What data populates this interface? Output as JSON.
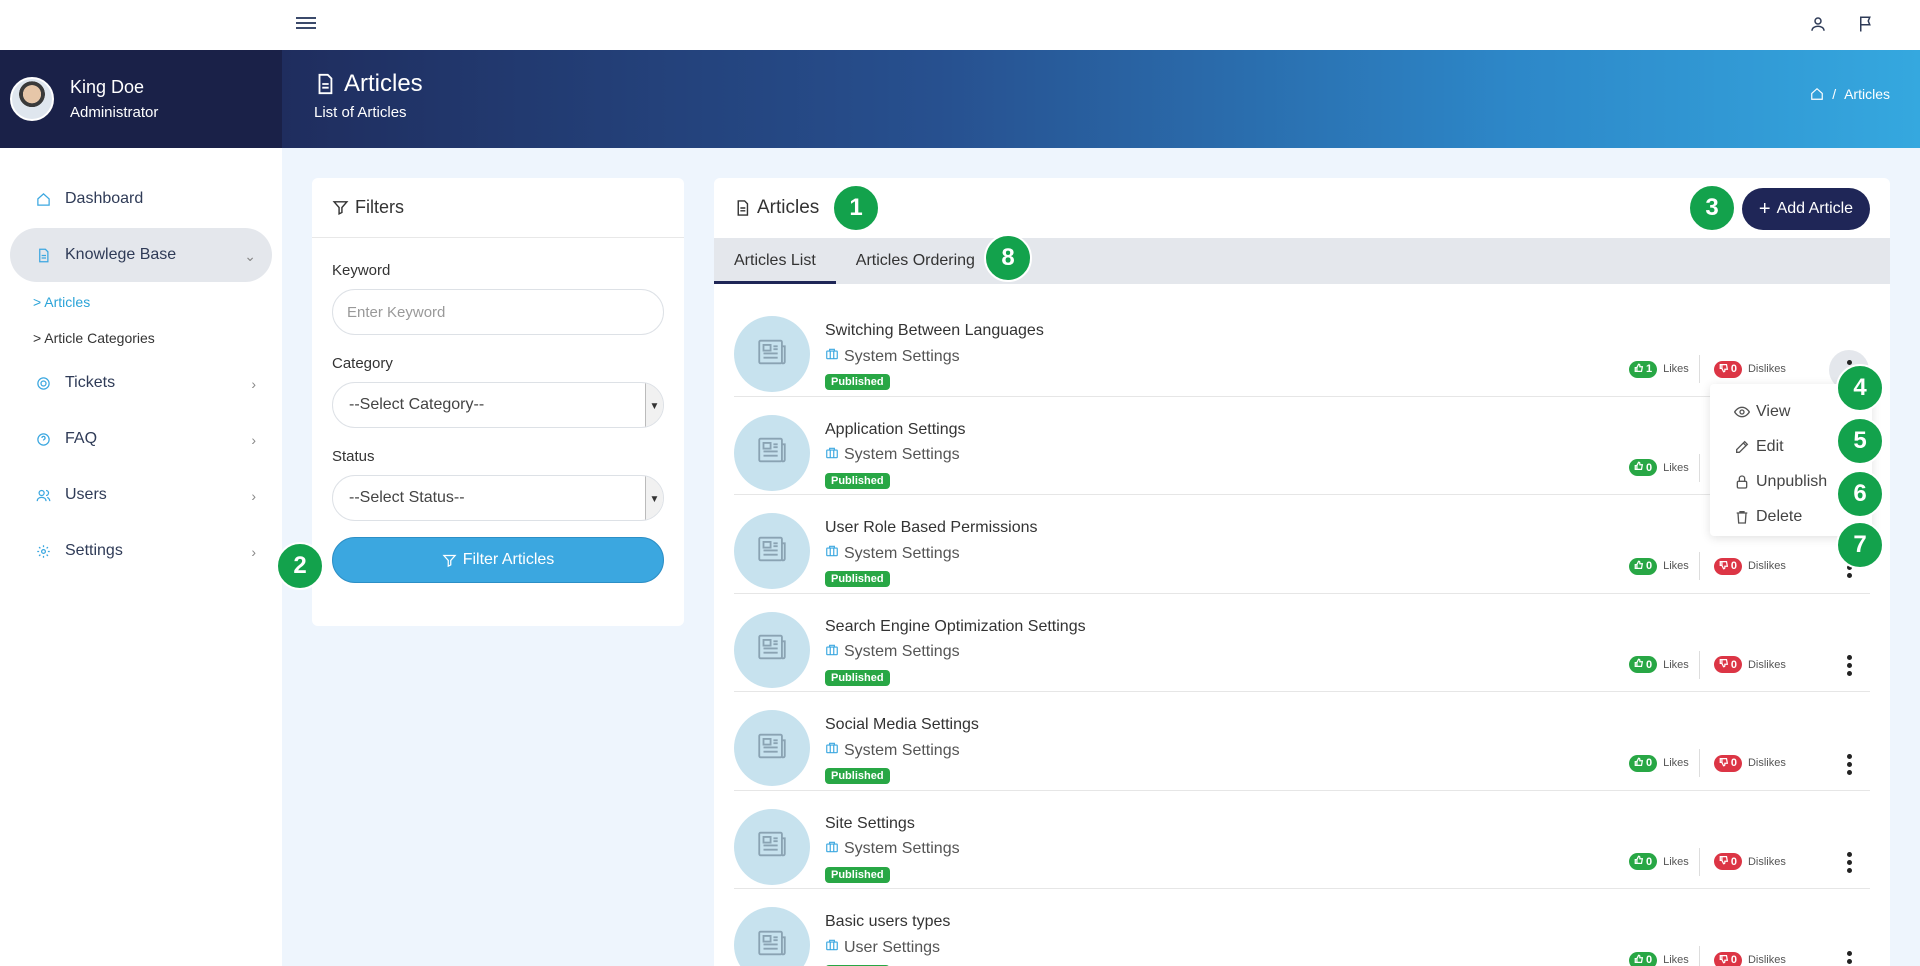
{
  "topbar": {
    "menu_icon": "hamburger-icon",
    "user_icon": "user-icon",
    "flag_icon": "flag-icon"
  },
  "profile": {
    "name": "King Doe",
    "role": "Administrator"
  },
  "sidebar": {
    "items": [
      {
        "label": "Dashboard",
        "icon": "home-icon"
      },
      {
        "label": "Knowlege Base",
        "icon": "document-icon"
      },
      {
        "label": "Tickets",
        "icon": "lifebuoy-icon"
      },
      {
        "label": "FAQ",
        "icon": "question-icon"
      },
      {
        "label": "Users",
        "icon": "users-icon"
      },
      {
        "label": "Settings",
        "icon": "gear-icon"
      }
    ],
    "sub_items": [
      {
        "label": "> Articles"
      },
      {
        "label": "> Article Categories"
      }
    ]
  },
  "header": {
    "title": "Articles",
    "subtitle": "List of Articles",
    "breadcrumb_current": "Articles",
    "breadcrumb_sep": "/"
  },
  "filters": {
    "title": "Filters",
    "keyword_label": "Keyword",
    "keyword_placeholder": "Enter Keyword",
    "category_label": "Category",
    "category_value": "--Select Category--",
    "status_label": "Status",
    "status_value": "--Select Status--",
    "button": "Filter Articles"
  },
  "articles": {
    "title": "Articles",
    "add_button": "Add Article",
    "tabs": [
      {
        "label": "Articles List"
      },
      {
        "label": "Articles Ordering"
      }
    ],
    "likes_label": "Likes",
    "dislikes_label": "Dislikes",
    "rows": [
      {
        "title": "Switching Between Languages",
        "category": "System Settings",
        "status": "Published",
        "likes": "1",
        "dislikes": "0"
      },
      {
        "title": "Application Settings",
        "category": "System Settings",
        "status": "Published",
        "likes": "0",
        "dislikes": "0"
      },
      {
        "title": "User Role Based Permissions",
        "category": "System Settings",
        "status": "Published",
        "likes": "0",
        "dislikes": "0"
      },
      {
        "title": "Search Engine Optimization Settings",
        "category": "System Settings",
        "status": "Published",
        "likes": "0",
        "dislikes": "0"
      },
      {
        "title": "Social Media Settings",
        "category": "System Settings",
        "status": "Published",
        "likes": "0",
        "dislikes": "0"
      },
      {
        "title": "Site Settings",
        "category": "System Settings",
        "status": "Published",
        "likes": "0",
        "dislikes": "0"
      },
      {
        "title": "Basic users types",
        "category": "User Settings",
        "status": "Published",
        "likes": "0",
        "dislikes": "0"
      }
    ]
  },
  "dropdown": {
    "items": [
      {
        "label": "View",
        "icon": "eye-icon"
      },
      {
        "label": "Edit",
        "icon": "edit-icon"
      },
      {
        "label": "Unpublish",
        "icon": "lock-icon"
      },
      {
        "label": "Delete",
        "icon": "trash-icon"
      }
    ]
  },
  "callouts": [
    "1",
    "2",
    "3",
    "4",
    "5",
    "6",
    "7",
    "8"
  ],
  "colors": {
    "navy": "#1f2657",
    "accent_blue": "#3ba7e0",
    "success": "#28a745",
    "danger": "#dc3545",
    "callout": "#13a24c"
  }
}
